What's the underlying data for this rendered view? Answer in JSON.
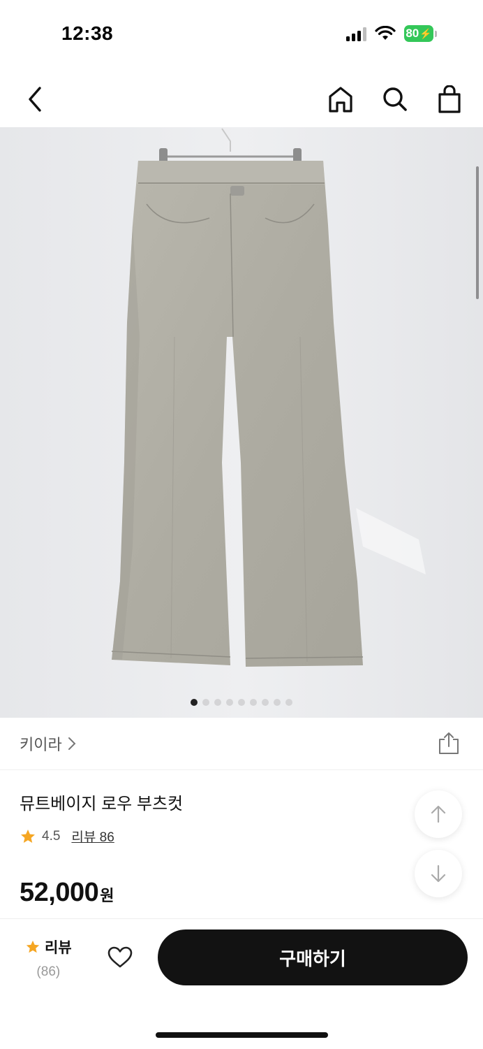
{
  "status_bar": {
    "time": "12:38",
    "battery": "80"
  },
  "nav": {
    "icons": [
      "back-icon",
      "home-icon",
      "search-icon",
      "shopping-bag-icon"
    ]
  },
  "gallery": {
    "image_alt": "뮤트베이지 로우 부츠컷",
    "page_count": 9,
    "current_page": 1
  },
  "product": {
    "brand": "키이라",
    "title": "뮤트베이지 로우 부츠컷",
    "rating": "4.5",
    "review_link": "리뷰 86",
    "price": "52,000",
    "currency": "원"
  },
  "bottom_bar": {
    "review_label": "리뷰",
    "review_count": "(86)",
    "buy_label": "구매하기"
  },
  "colors": {
    "accent_star": "#f5a623",
    "buy_button": "#121212",
    "battery": "#34c759"
  }
}
